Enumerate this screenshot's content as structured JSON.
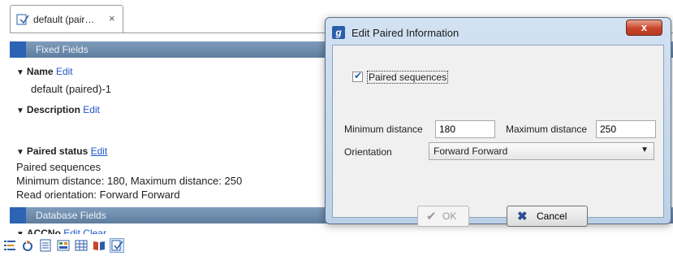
{
  "tab": {
    "label": "default (pair…",
    "close": "×"
  },
  "sections": {
    "fixed": "Fixed Fields",
    "database": "Database Fields"
  },
  "fields": {
    "name": {
      "title": "Name",
      "edit": "Edit",
      "value": "default (paired)-1"
    },
    "description": {
      "title": "Description",
      "edit": "Edit"
    },
    "paired": {
      "title": "Paired status",
      "edit": "Edit",
      "line1": "Paired sequences",
      "line2": "Minimum distance: 180, Maximum distance: 250",
      "line3": "Read orientation: Forward Forward"
    },
    "accno": {
      "title": "ACCNo",
      "edit": "Edit",
      "clear": "Clear"
    }
  },
  "dialog": {
    "title": "Edit Paired Information",
    "close": "x",
    "checkbox_label": "Paired sequences",
    "checkbox_checked": true,
    "min_label": "Minimum distance",
    "min_value": "180",
    "max_label": "Maximum distance",
    "max_value": "250",
    "orientation_label": "Orientation",
    "orientation_value": "Forward Forward",
    "ok": "OK",
    "cancel": "Cancel"
  },
  "icons": {
    "toolbar": [
      "text-view-icon",
      "refresh-icon",
      "table-icon",
      "compare-icon",
      "grid-icon",
      "book-icon",
      "document-edit-icon"
    ]
  }
}
